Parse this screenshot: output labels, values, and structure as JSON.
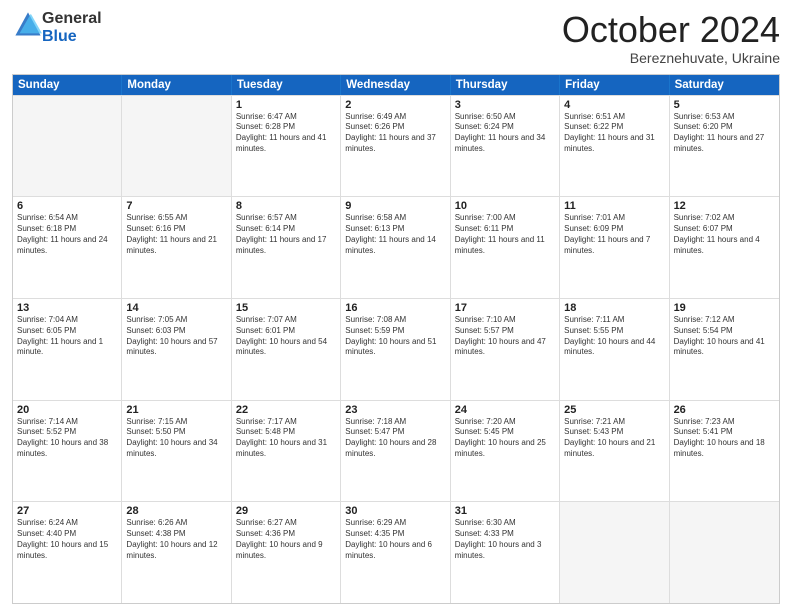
{
  "header": {
    "logo_general": "General",
    "logo_blue": "Blue",
    "month": "October 2024",
    "location": "Bereznehuvate, Ukraine"
  },
  "days_of_week": [
    "Sunday",
    "Monday",
    "Tuesday",
    "Wednesday",
    "Thursday",
    "Friday",
    "Saturday"
  ],
  "rows": [
    [
      {
        "day": "",
        "text": "",
        "empty": true
      },
      {
        "day": "",
        "text": "",
        "empty": true
      },
      {
        "day": "1",
        "text": "Sunrise: 6:47 AM\nSunset: 6:28 PM\nDaylight: 11 hours and 41 minutes."
      },
      {
        "day": "2",
        "text": "Sunrise: 6:49 AM\nSunset: 6:26 PM\nDaylight: 11 hours and 37 minutes."
      },
      {
        "day": "3",
        "text": "Sunrise: 6:50 AM\nSunset: 6:24 PM\nDaylight: 11 hours and 34 minutes."
      },
      {
        "day": "4",
        "text": "Sunrise: 6:51 AM\nSunset: 6:22 PM\nDaylight: 11 hours and 31 minutes."
      },
      {
        "day": "5",
        "text": "Sunrise: 6:53 AM\nSunset: 6:20 PM\nDaylight: 11 hours and 27 minutes."
      }
    ],
    [
      {
        "day": "6",
        "text": "Sunrise: 6:54 AM\nSunset: 6:18 PM\nDaylight: 11 hours and 24 minutes."
      },
      {
        "day": "7",
        "text": "Sunrise: 6:55 AM\nSunset: 6:16 PM\nDaylight: 11 hours and 21 minutes."
      },
      {
        "day": "8",
        "text": "Sunrise: 6:57 AM\nSunset: 6:14 PM\nDaylight: 11 hours and 17 minutes."
      },
      {
        "day": "9",
        "text": "Sunrise: 6:58 AM\nSunset: 6:13 PM\nDaylight: 11 hours and 14 minutes."
      },
      {
        "day": "10",
        "text": "Sunrise: 7:00 AM\nSunset: 6:11 PM\nDaylight: 11 hours and 11 minutes."
      },
      {
        "day": "11",
        "text": "Sunrise: 7:01 AM\nSunset: 6:09 PM\nDaylight: 11 hours and 7 minutes."
      },
      {
        "day": "12",
        "text": "Sunrise: 7:02 AM\nSunset: 6:07 PM\nDaylight: 11 hours and 4 minutes."
      }
    ],
    [
      {
        "day": "13",
        "text": "Sunrise: 7:04 AM\nSunset: 6:05 PM\nDaylight: 11 hours and 1 minute."
      },
      {
        "day": "14",
        "text": "Sunrise: 7:05 AM\nSunset: 6:03 PM\nDaylight: 10 hours and 57 minutes."
      },
      {
        "day": "15",
        "text": "Sunrise: 7:07 AM\nSunset: 6:01 PM\nDaylight: 10 hours and 54 minutes."
      },
      {
        "day": "16",
        "text": "Sunrise: 7:08 AM\nSunset: 5:59 PM\nDaylight: 10 hours and 51 minutes."
      },
      {
        "day": "17",
        "text": "Sunrise: 7:10 AM\nSunset: 5:57 PM\nDaylight: 10 hours and 47 minutes."
      },
      {
        "day": "18",
        "text": "Sunrise: 7:11 AM\nSunset: 5:55 PM\nDaylight: 10 hours and 44 minutes."
      },
      {
        "day": "19",
        "text": "Sunrise: 7:12 AM\nSunset: 5:54 PM\nDaylight: 10 hours and 41 minutes."
      }
    ],
    [
      {
        "day": "20",
        "text": "Sunrise: 7:14 AM\nSunset: 5:52 PM\nDaylight: 10 hours and 38 minutes."
      },
      {
        "day": "21",
        "text": "Sunrise: 7:15 AM\nSunset: 5:50 PM\nDaylight: 10 hours and 34 minutes."
      },
      {
        "day": "22",
        "text": "Sunrise: 7:17 AM\nSunset: 5:48 PM\nDaylight: 10 hours and 31 minutes."
      },
      {
        "day": "23",
        "text": "Sunrise: 7:18 AM\nSunset: 5:47 PM\nDaylight: 10 hours and 28 minutes."
      },
      {
        "day": "24",
        "text": "Sunrise: 7:20 AM\nSunset: 5:45 PM\nDaylight: 10 hours and 25 minutes."
      },
      {
        "day": "25",
        "text": "Sunrise: 7:21 AM\nSunset: 5:43 PM\nDaylight: 10 hours and 21 minutes."
      },
      {
        "day": "26",
        "text": "Sunrise: 7:23 AM\nSunset: 5:41 PM\nDaylight: 10 hours and 18 minutes."
      }
    ],
    [
      {
        "day": "27",
        "text": "Sunrise: 6:24 AM\nSunset: 4:40 PM\nDaylight: 10 hours and 15 minutes."
      },
      {
        "day": "28",
        "text": "Sunrise: 6:26 AM\nSunset: 4:38 PM\nDaylight: 10 hours and 12 minutes."
      },
      {
        "day": "29",
        "text": "Sunrise: 6:27 AM\nSunset: 4:36 PM\nDaylight: 10 hours and 9 minutes."
      },
      {
        "day": "30",
        "text": "Sunrise: 6:29 AM\nSunset: 4:35 PM\nDaylight: 10 hours and 6 minutes."
      },
      {
        "day": "31",
        "text": "Sunrise: 6:30 AM\nSunset: 4:33 PM\nDaylight: 10 hours and 3 minutes."
      },
      {
        "day": "",
        "text": "",
        "empty": true
      },
      {
        "day": "",
        "text": "",
        "empty": true
      }
    ]
  ]
}
